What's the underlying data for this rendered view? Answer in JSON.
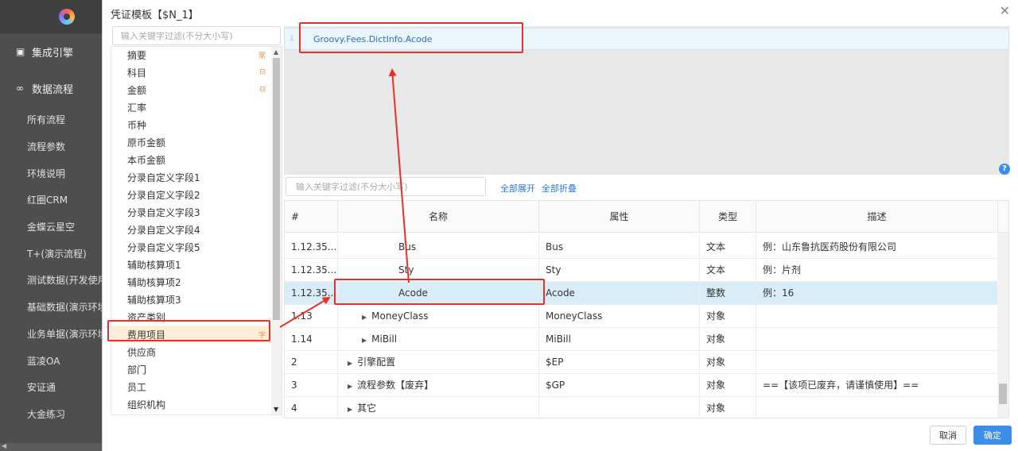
{
  "app_sidebar": {
    "sections": [
      {
        "icon": "integration-icon",
        "label": "集成引擎"
      },
      {
        "icon": "infinity-icon",
        "label": "数据流程"
      }
    ],
    "items": [
      "所有流程",
      "流程参数",
      "环境说明",
      "红圈CRM",
      "金蝶云星空",
      "T+(演示流程)",
      "测试数据(开发使用",
      "基础数据(演示环境",
      "业务单据(演示环境",
      "蓝凌OA",
      "安证通",
      "大金练习"
    ]
  },
  "dialog": {
    "title": "凭证模板【$N_1】",
    "close_icon": "close-icon"
  },
  "tree": {
    "filter_placeholder": "输入关键字过滤(不分大小写)",
    "items": [
      {
        "label": "摘要",
        "badge": "常"
      },
      {
        "label": "科目",
        "badge": "⊟"
      },
      {
        "label": "金额",
        "badge": "⊟"
      },
      {
        "label": "汇率",
        "badge": ""
      },
      {
        "label": "币种",
        "badge": ""
      },
      {
        "label": "原币金额",
        "badge": ""
      },
      {
        "label": "本币金额",
        "badge": ""
      },
      {
        "label": "分录自定义字段1",
        "badge": ""
      },
      {
        "label": "分录自定义字段2",
        "badge": ""
      },
      {
        "label": "分录自定义字段3",
        "badge": ""
      },
      {
        "label": "分录自定义字段4",
        "badge": ""
      },
      {
        "label": "分录自定义字段5",
        "badge": ""
      },
      {
        "label": "辅助核算项1",
        "badge": ""
      },
      {
        "label": "辅助核算项2",
        "badge": ""
      },
      {
        "label": "辅助核算项3",
        "badge": ""
      },
      {
        "label": "资产类别",
        "badge": ""
      },
      {
        "label": "费用项目",
        "badge": "字",
        "selected": true
      },
      {
        "label": "供应商",
        "badge": ""
      },
      {
        "label": "部门",
        "badge": ""
      },
      {
        "label": "员工",
        "badge": ""
      },
      {
        "label": "组织机构",
        "badge": ""
      }
    ]
  },
  "editor": {
    "line_number": "1",
    "code": "Groovy.Fees.DictInfo.Acode"
  },
  "table_toolbar": {
    "filter_placeholder": "输入关键字过滤(不分大小写)",
    "expand_all": "全部展开",
    "collapse_all": "全部折叠"
  },
  "table": {
    "headers": {
      "idx": "#",
      "name": "名称",
      "attr": "属性",
      "type": "类型",
      "desc": "描述"
    },
    "rows": [
      {
        "idx": "1.12.35...",
        "name": "Bus",
        "attr": "Bus",
        "type": "文本",
        "desc": "例：山东鲁抗医药股份有限公司",
        "indent": 3,
        "caret": false
      },
      {
        "idx": "1.12.35...",
        "name": "Sty",
        "attr": "Sty",
        "type": "文本",
        "desc": "例：片剂",
        "indent": 3,
        "caret": false
      },
      {
        "idx": "1.12.35...",
        "name": "Acode",
        "attr": "Acode",
        "type": "整数",
        "desc": "例：16",
        "indent": 3,
        "caret": false,
        "selected": true
      },
      {
        "idx": "1.13",
        "name": "MoneyClass",
        "attr": "MoneyClass",
        "type": "对象",
        "desc": "",
        "indent": 2,
        "caret": true
      },
      {
        "idx": "1.14",
        "name": "MiBill",
        "attr": "MiBill",
        "type": "对象",
        "desc": "",
        "indent": 2,
        "caret": true
      },
      {
        "idx": "2",
        "name": "引擎配置",
        "attr": "$EP",
        "type": "对象",
        "desc": "",
        "indent": 1,
        "caret": true
      },
      {
        "idx": "3",
        "name": "流程参数【废弃】",
        "attr": "$GP",
        "type": "对象",
        "desc": "==【该项已废弃，请谨慎使用】==",
        "indent": 1,
        "caret": true
      },
      {
        "idx": "4",
        "name": "其它",
        "attr": "",
        "type": "对象",
        "desc": "",
        "indent": 1,
        "caret": true
      }
    ]
  },
  "footer": {
    "cancel": "取消",
    "ok": "确定"
  },
  "help_icon_glyph": "?",
  "colors": {
    "annotation_red": "#e8302a",
    "accent_blue": "#3d8ee8",
    "selected_row": "#d9edf8",
    "selected_tree_item": "#fdeed9"
  }
}
